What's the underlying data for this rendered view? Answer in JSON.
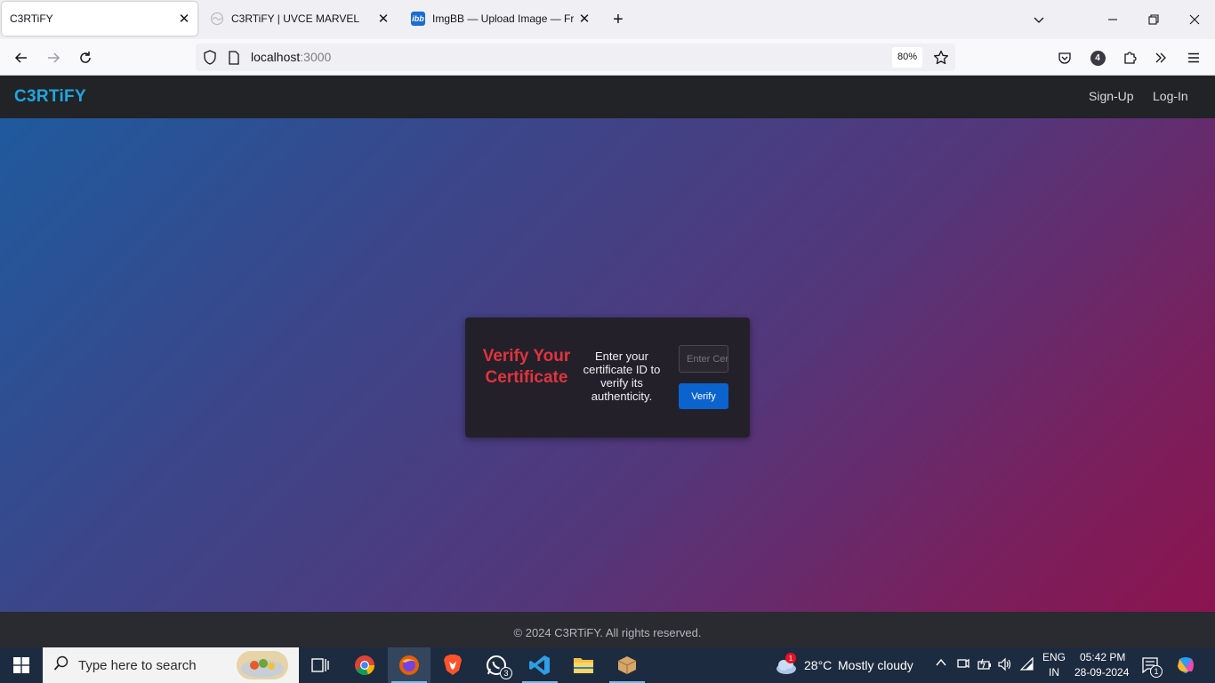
{
  "browser": {
    "tabs": [
      {
        "title": "C3RTiFY",
        "active": true
      },
      {
        "title": "C3RTiFY | UVCE MARVEL",
        "active": false
      },
      {
        "title": "ImgBB — Upload Image — Free",
        "active": false,
        "favicon_text": "ibb"
      }
    ],
    "url_host": "localhost",
    "url_port": ":3000",
    "zoom": "80%",
    "extensions_count": "4"
  },
  "site": {
    "logo": "C3RTiFY",
    "nav": {
      "signup": "Sign-Up",
      "login": "Log-In"
    },
    "card": {
      "heading": "Verify Your Certificate",
      "description": "Enter your certificate ID to verify its authenticity.",
      "input_placeholder": "Enter Certificate ID",
      "button": "Verify"
    },
    "footer": "© 2024 C3RTiFY. All rights reserved."
  },
  "taskbar": {
    "search_placeholder": "Type here to search",
    "whatsapp_badge": "3",
    "weather": {
      "temp": "28°C",
      "desc": "Mostly cloudy",
      "alert": "1"
    },
    "lang": "ENG",
    "region": "IN",
    "time": "05:42 PM",
    "date": "28-09-2024",
    "notifications": "1"
  },
  "colors": {
    "accent_logo": "#1ea7e1",
    "heading_red": "#e0343d",
    "button_blue": "#0b63ce"
  }
}
